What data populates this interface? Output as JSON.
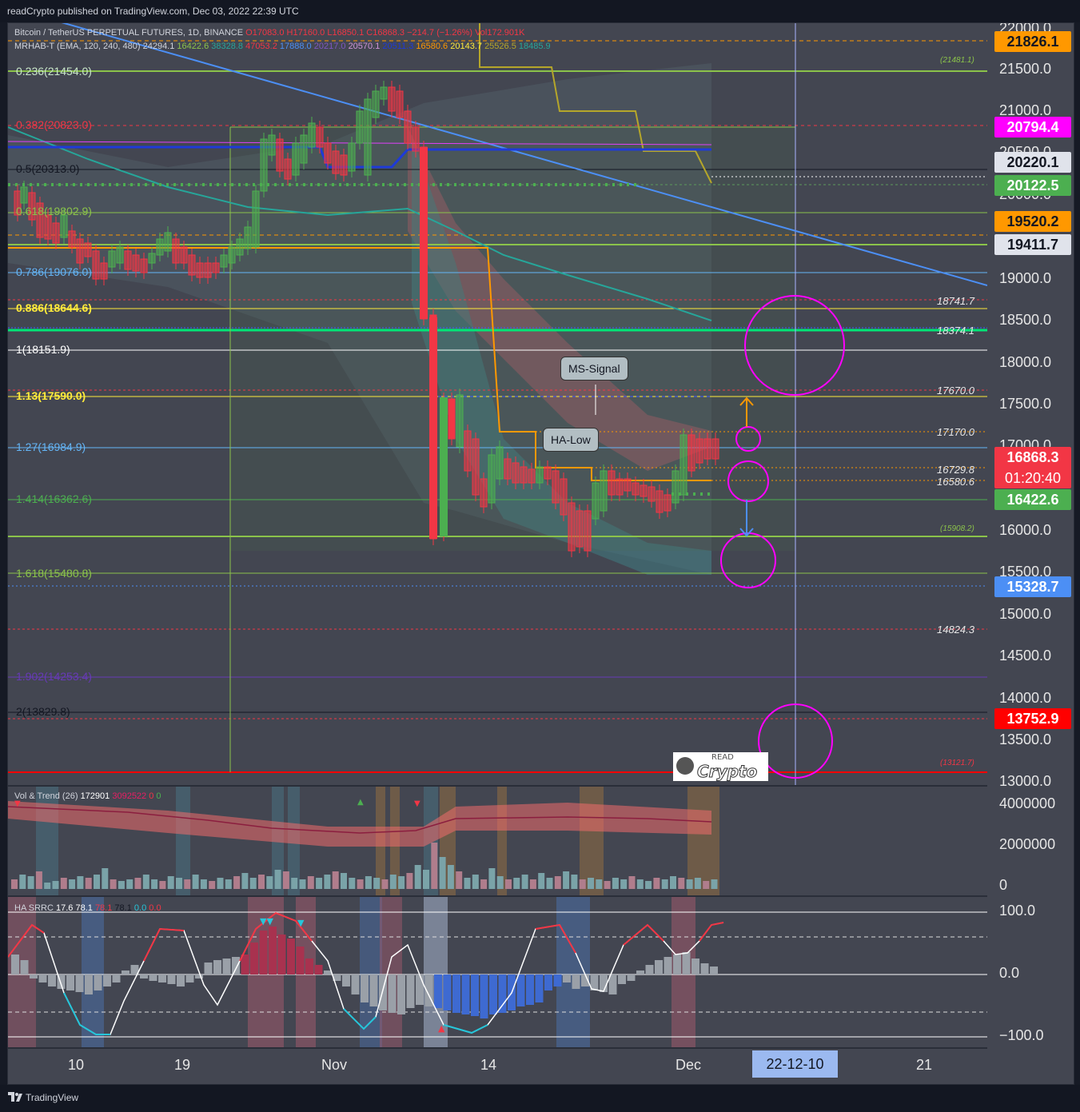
{
  "header": {
    "publisher_line": "readCrypto published on TradingView.com, Dec 03, 2022 22:39 UTC"
  },
  "legend": {
    "symbol_line": "Bitcoin / TetherUS PERPETUAL FUTURES, 1D, BINANCE",
    "ohlc": {
      "o": "O17083.0",
      "h": "H17160.0",
      "l": "L16850.1",
      "c": "C16868.3",
      "chg": "−214.7 (−1.26%)",
      "vol": "Vol172.901K"
    },
    "indicator_name": "MRHAB-T (EMA, 120, 240, 480)",
    "indicator_values": [
      "24294.1",
      "16422.6",
      "38328.8",
      "47053.2",
      "17888.0",
      "20217.0",
      "20570.1",
      "20511.3",
      "16580.6",
      "20143.7",
      "25526.5",
      "18485.9"
    ],
    "vol_name": "Vol & Trend (26)",
    "vol_values": [
      "172901",
      "3092522",
      "0",
      "0"
    ],
    "ha_name": "HA SRRC",
    "ha_values": [
      "17.6",
      "78.1",
      "78.1",
      "78.1",
      "0.0",
      "0.0"
    ]
  },
  "price_axis": {
    "ticks": [
      "22000.0",
      "21500.0",
      "21000.0",
      "20500.0",
      "20000.0",
      "19000.0",
      "18500.0",
      "18000.0",
      "17500.0",
      "17000.0",
      "16000.0",
      "15500.0",
      "15000.0",
      "14500.0",
      "14000.0",
      "13500.0",
      "13000.0"
    ],
    "labels": [
      {
        "text": "21826.1",
        "bg": "#ff9800",
        "fg": "#131722"
      },
      {
        "text": "20794.4",
        "bg": "#ff00ff",
        "fg": "#ffffff"
      },
      {
        "text": "20220.1",
        "bg": "#e0e3eb",
        "fg": "#131722"
      },
      {
        "text": "20122.5",
        "bg": "#4caf50",
        "fg": "#ffffff"
      },
      {
        "text": "19520.2",
        "bg": "#ff9800",
        "fg": "#131722"
      },
      {
        "text": "19411.7",
        "bg": "#e0e3eb",
        "fg": "#131722"
      },
      {
        "text": "16422.6",
        "bg": "#4caf50",
        "fg": "#ffffff"
      },
      {
        "text": "15328.7",
        "bg": "#4c8ff5",
        "fg": "#ffffff"
      },
      {
        "text": "13752.9",
        "bg": "#ff0000",
        "fg": "#ffffff"
      }
    ],
    "last_price": "16868.3",
    "countdown": "01:20:40",
    "vol_ticks": [
      "4000000",
      "2000000",
      "0"
    ],
    "ha_ticks": [
      "100.0",
      "0.0",
      "−100.0"
    ]
  },
  "fib_levels": [
    {
      "text": "0.236(21454.0)",
      "color": "#c8e6c9"
    },
    {
      "text": "0.382(20823.0)",
      "color": "#f23645"
    },
    {
      "text": "0.5(20313.0)",
      "color": "#131722"
    },
    {
      "text": "0.618(19802.9)",
      "color": "#8bc34a"
    },
    {
      "text": "0.786(19076.0)",
      "color": "#64b5f6"
    },
    {
      "text": "0.886(18644.6)",
      "color": "#ffeb3b"
    },
    {
      "text": "1(18151.9)",
      "color": "#ffffff"
    },
    {
      "text": "1.13(17590.0)",
      "color": "#ffeb3b"
    },
    {
      "text": "1.27(16984.9)",
      "color": "#64b5f6"
    },
    {
      "text": "1.414(16362.6)",
      "color": "#4caf50"
    },
    {
      "text": "1.618(15480.8)",
      "color": "#8bc34a"
    },
    {
      "text": "1.902(14253.4)",
      "color": "#673ab7"
    },
    {
      "text": "2(13829.8)",
      "color": "#131722"
    }
  ],
  "level_labels": [
    "(21481.1)",
    "18741.7",
    "18374.1",
    "17670.0",
    "17170.0",
    "16729.8",
    "16580.6",
    "(15908.2)",
    "14824.3",
    "(13121.7)"
  ],
  "annotations": {
    "ms_signal": "MS-Signal",
    "ha_low": "HA-Low"
  },
  "time_axis": {
    "labels": [
      "10",
      "19",
      "Nov",
      "14",
      "Dec",
      "21"
    ],
    "highlight": "22-12-10"
  },
  "logo": {
    "small": "READ",
    "big": "Crypto"
  },
  "footer": {
    "brand": "TradingView"
  },
  "colors": {
    "bull": "#4caf50",
    "bear": "#f23645",
    "background": "#434651",
    "accent_magenta": "#ff00ff"
  }
}
